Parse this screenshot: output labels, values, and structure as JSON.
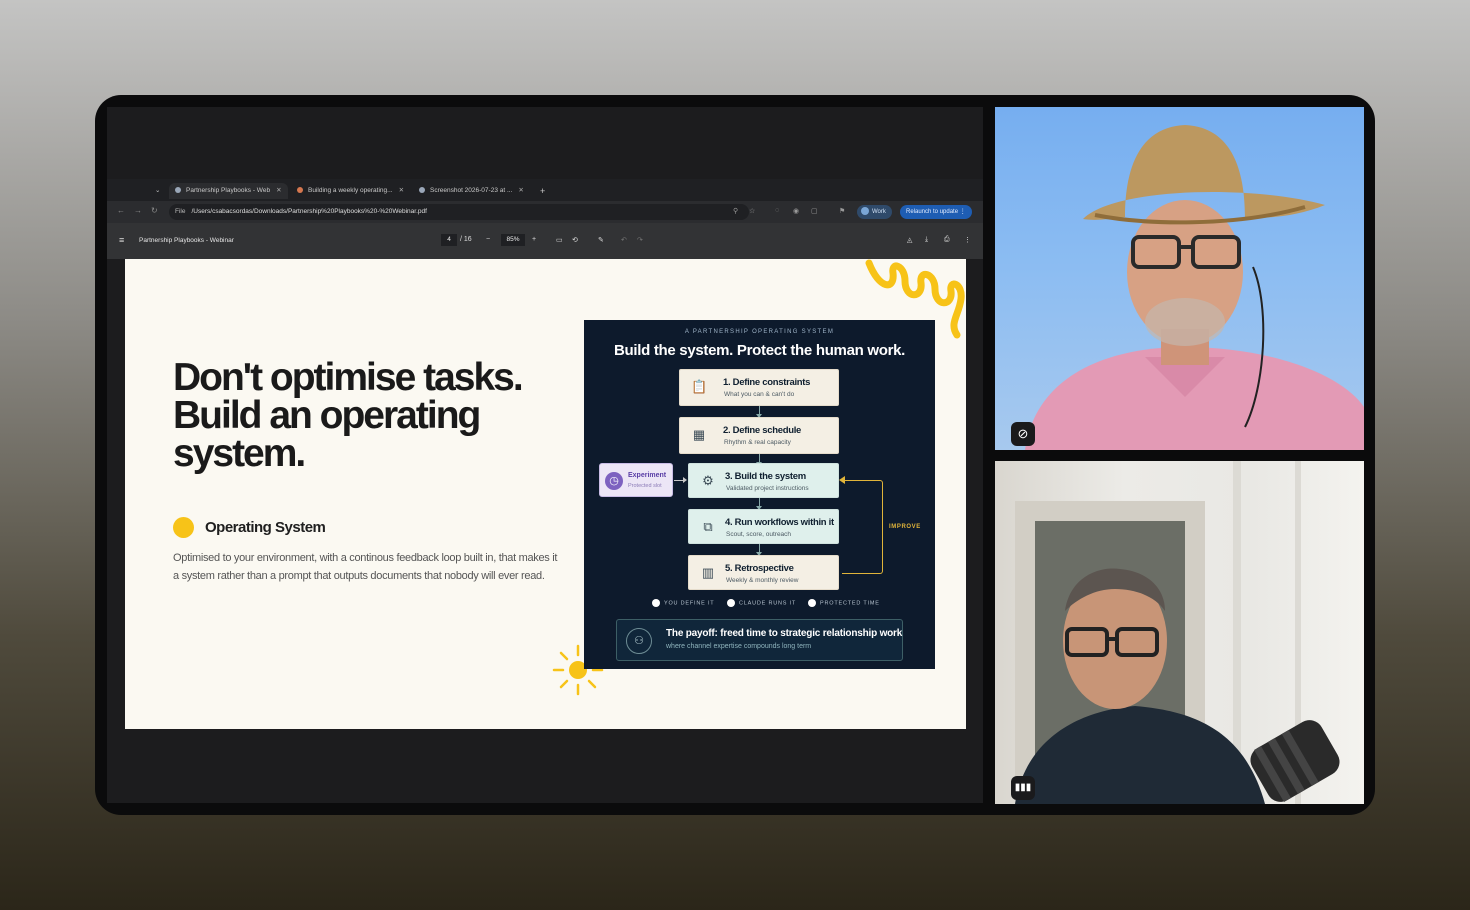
{
  "browser": {
    "tabs": [
      {
        "label": "Partnership Playbooks - Web",
        "icon": "globe-icon"
      },
      {
        "label": "Building a weekly operating...",
        "icon": "claude-icon"
      },
      {
        "label": "Screenshot 2026-07-23 at ...",
        "icon": "globe-icon"
      }
    ],
    "file_chip": "File",
    "url": "/Users/csabacsordas/Downloads/Partnership%20Playbooks%20-%20Webinar.pdf",
    "profile_label": "Work",
    "relaunch_label": "Relaunch to update"
  },
  "pdf_viewer": {
    "title": "Partnership Playbooks - Webinar",
    "page_current": "4",
    "page_total": "/ 16",
    "zoom": "85%"
  },
  "slide": {
    "headline": "Don't optimise tasks. Build an operating system.",
    "section_title": "Operating System",
    "section_desc": "Optimised to your environment, with a continous feedback loop built in, that makes it a system rather than a prompt that outputs documents that nobody will ever read.",
    "accent_color": "#f7c318",
    "panel": {
      "kicker": "A PARTNERSHIP OPERATING SYSTEM",
      "title": "Build the system. Protect the human work.",
      "steps": [
        {
          "title": "1. Define constraints",
          "sub": "What you can & can't do",
          "icon": "clipboard-icon"
        },
        {
          "title": "2. Define schedule",
          "sub": "Rhythm & real capacity",
          "icon": "calendar-icon"
        },
        {
          "title": "3. Build the system",
          "sub": "Validated project instructions",
          "icon": "gear-icon"
        },
        {
          "title": "4. Run workflows within it",
          "sub": "Scout, score, outreach",
          "icon": "workflow-icon"
        },
        {
          "title": "5. Retrospective",
          "sub": "Weekly & monthly review",
          "icon": "chart-icon"
        }
      ],
      "experiment": {
        "title": "Experiment",
        "sub": "Protected slot"
      },
      "improve_label": "IMPROVE",
      "legend": [
        "YOU DEFINE IT",
        "CLAUDE RUNS IT",
        "PROTECTED TIME"
      ],
      "payoff": {
        "title": "The payoff: freed time to strategic relationship work",
        "sub": "where channel expertise compounds long term"
      }
    }
  },
  "participants": [
    {
      "status_icon": "mic-muted-icon"
    },
    {
      "status_icon": "speaking-icon"
    }
  ]
}
